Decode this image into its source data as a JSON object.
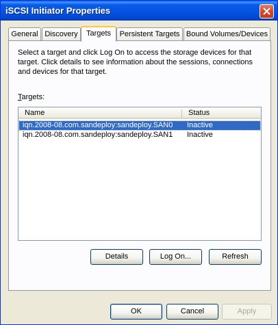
{
  "window": {
    "title": "iSCSI Initiator Properties"
  },
  "tabs": [
    {
      "label": "General"
    },
    {
      "label": "Discovery"
    },
    {
      "label": "Targets"
    },
    {
      "label": "Persistent Targets"
    },
    {
      "label": "Bound Volumes/Devices"
    }
  ],
  "active_tab": "Targets",
  "description": "Select a target and click Log On to access the storage devices for that target. Click details to see information about the sessions, connections and devices for that target.",
  "targets_label": "Targets:",
  "list": {
    "columns": [
      {
        "label": "Name"
      },
      {
        "label": "Status"
      }
    ],
    "rows": [
      {
        "name": "iqn.2008-08.com.sandeploy:sandeploy.SAN0",
        "status": "Inactive",
        "selected": true
      },
      {
        "name": "iqn.2008-08.com.sandeploy:sandeploy.SAN1",
        "status": "Inactive",
        "selected": false
      }
    ]
  },
  "buttons": {
    "details": "Details",
    "logon": "Log On...",
    "refresh": "Refresh",
    "ok": "OK",
    "cancel": "Cancel",
    "apply": "Apply"
  },
  "colors": {
    "titlebar": "#0a5ce7",
    "selection": "#316ac5",
    "active_tab_accent": "#ffc83c"
  },
  "icons": {
    "close": "close-icon"
  }
}
